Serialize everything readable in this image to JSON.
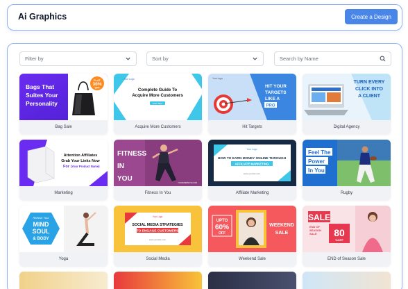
{
  "header": {
    "title": "Ai Graphics",
    "create_button": "Create a Design"
  },
  "filters": {
    "filter_by": "Filter by",
    "sort_by": "Sort by",
    "search_placeholder": "Search by Name"
  },
  "cards": [
    {
      "caption": "Bag Sale",
      "text": {
        "l1": "Bags That",
        "l2": "Suites Your",
        "l3": "Personality",
        "badge1": "FLAT",
        "badge2": "30%",
        "badge3": "OFF"
      }
    },
    {
      "caption": "Acquire More Customers",
      "text": {
        "logo": "Your Logo",
        "l1": "Complete Guide To",
        "l2": "Acquire More Customers",
        "btn": "Learn More"
      }
    },
    {
      "caption": "Hit Targets",
      "text": {
        "logo": "Your Logo",
        "l1": "HIT YOUR",
        "l2": "TARGETS",
        "l3": "LIKE A",
        "l4": "PRO"
      }
    },
    {
      "caption": "Digital Agency",
      "text": {
        "l1": "TURN EVERY",
        "l2": "CLICK INTO",
        "l3": "A CLIENT"
      }
    },
    {
      "caption": "Marketing",
      "text": {
        "l1": "Attention Affiliates",
        "l2": "Grab Your Links Now",
        "l3": "For",
        "l4": "(Your Product Name)"
      }
    },
    {
      "caption": "Fitness In You",
      "text": {
        "l1": "FITNESS",
        "l2": "IN",
        "l3": "YOU",
        "site": "YOURWEBSITE.COM"
      }
    },
    {
      "caption": "Affiliate Marketing",
      "text": {
        "logo": "Your Logo",
        "l1": "HOW TO EARN MONEY ONLINE THROUGH",
        "l2": "AFFILIATE MARKETING",
        "site": "www.yoursite.com"
      }
    },
    {
      "caption": "Rugby",
      "text": {
        "l1": "Feel The",
        "l2": "Power",
        "l3": "In You"
      }
    },
    {
      "caption": "Yoga",
      "text": {
        "l1": "Refresh Your",
        "l2": "MIND",
        "l3": "SOUL",
        "l4": "& BODY"
      }
    },
    {
      "caption": "Social Media",
      "text": {
        "logo": "Your Logo",
        "l1": "SOCIAL MEDIA STRATEGIES",
        "l2": "TO ENGAGE CUSTOMERS",
        "site": "www.yoursite.com"
      }
    },
    {
      "caption": "Weekend Sale",
      "text": {
        "l1": "UPTO",
        "l2": "60%",
        "l3": "OFF",
        "l4": "WEEKEND",
        "l5": "SALE"
      }
    },
    {
      "caption": "END of Season Sale",
      "text": {
        "l1": "SALE",
        "l2": "END OF",
        "l3": "SEASON",
        "l4": "SALE",
        "l5": "80",
        "l6": "%OFF"
      }
    }
  ],
  "colors": {
    "accent": "#4a86e8",
    "border": "#8fb3ef"
  }
}
